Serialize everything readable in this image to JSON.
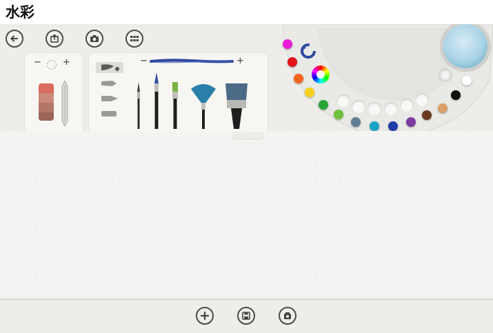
{
  "window": {
    "title": "水彩"
  },
  "toolbar": {
    "back_icon": "back-arrow-icon",
    "open_icon": "open-image-icon",
    "camera_icon": "camera-icon",
    "gallery_icon": "gallery-icon"
  },
  "size_panel": {
    "minus": "−",
    "plus": "+",
    "eraser_icon": "eraser-icon",
    "pencil_icon": "pencil-icon"
  },
  "brush_panel": {
    "minus": "−",
    "plus": "+",
    "shapes": [
      "brush-shape-wide",
      "brush-shape-angled",
      "brush-shape-round",
      "brush-shape-flat"
    ],
    "brushes": [
      "fine-round-brush",
      "round-brush",
      "flat-brush",
      "fan-brush",
      "wide-flat-brush"
    ],
    "stroke_color": "#2e4aa0"
  },
  "palette": {
    "colors": [
      "#e91bd5",
      "#e5131c",
      "#f5631a",
      "#f6d21a",
      "#27a537",
      "#6fc33c",
      "#607d94",
      "#1aa3c4",
      "#1f3eaa",
      "#7b3ba0",
      "#6b3a1f",
      "#d9a06b",
      "#111111",
      "#ffffff"
    ],
    "water_icon": "water-cup-icon",
    "undo_icon": "undo-icon",
    "color_wheel_icon": "color-wheel-icon",
    "mixer_icon": "color-mixer-icon"
  },
  "bottom": {
    "new_icon": "add-icon",
    "save_icon": "save-icon",
    "share_icon": "share-icon"
  }
}
